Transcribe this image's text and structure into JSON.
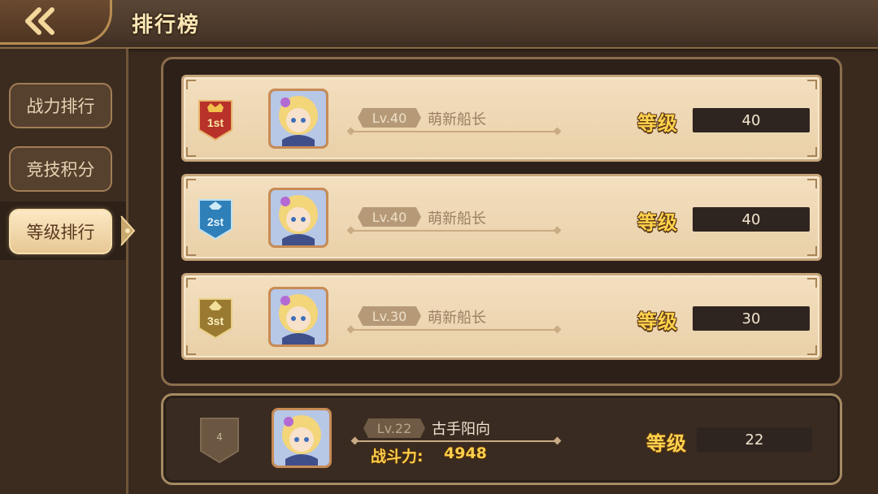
{
  "header": {
    "title": "排行榜",
    "back_icon": "double-chevron-left-icon"
  },
  "sidebar": {
    "tabs": [
      {
        "label": "战力排行",
        "active": false
      },
      {
        "label": "竞技积分",
        "active": false
      },
      {
        "label": "等级排行",
        "active": true
      }
    ]
  },
  "ranking": {
    "rows": [
      {
        "rank": "1st",
        "level_tag": "Lv.40",
        "name": "萌新船长",
        "value_label": "等级",
        "value": "40",
        "badge_color": "#b8322a"
      },
      {
        "rank": "2st",
        "level_tag": "Lv.40",
        "name": "萌新船长",
        "value_label": "等级",
        "value": "40",
        "badge_color": "#2f7fb8"
      },
      {
        "rank": "3st",
        "level_tag": "Lv.30",
        "name": "萌新船长",
        "value_label": "等级",
        "value": "30",
        "badge_color": "#9a7a30"
      }
    ]
  },
  "my_rank": {
    "rank": "4",
    "level_tag": "Lv.22",
    "name": "古手阳向",
    "power_label": "战斗力:",
    "power_value": "4948",
    "value_label": "等级",
    "value": "22"
  },
  "colors": {
    "gold_text": "#ffd24c",
    "panel_bg": "#2c2019",
    "row_bg": "#f3dfbf"
  }
}
